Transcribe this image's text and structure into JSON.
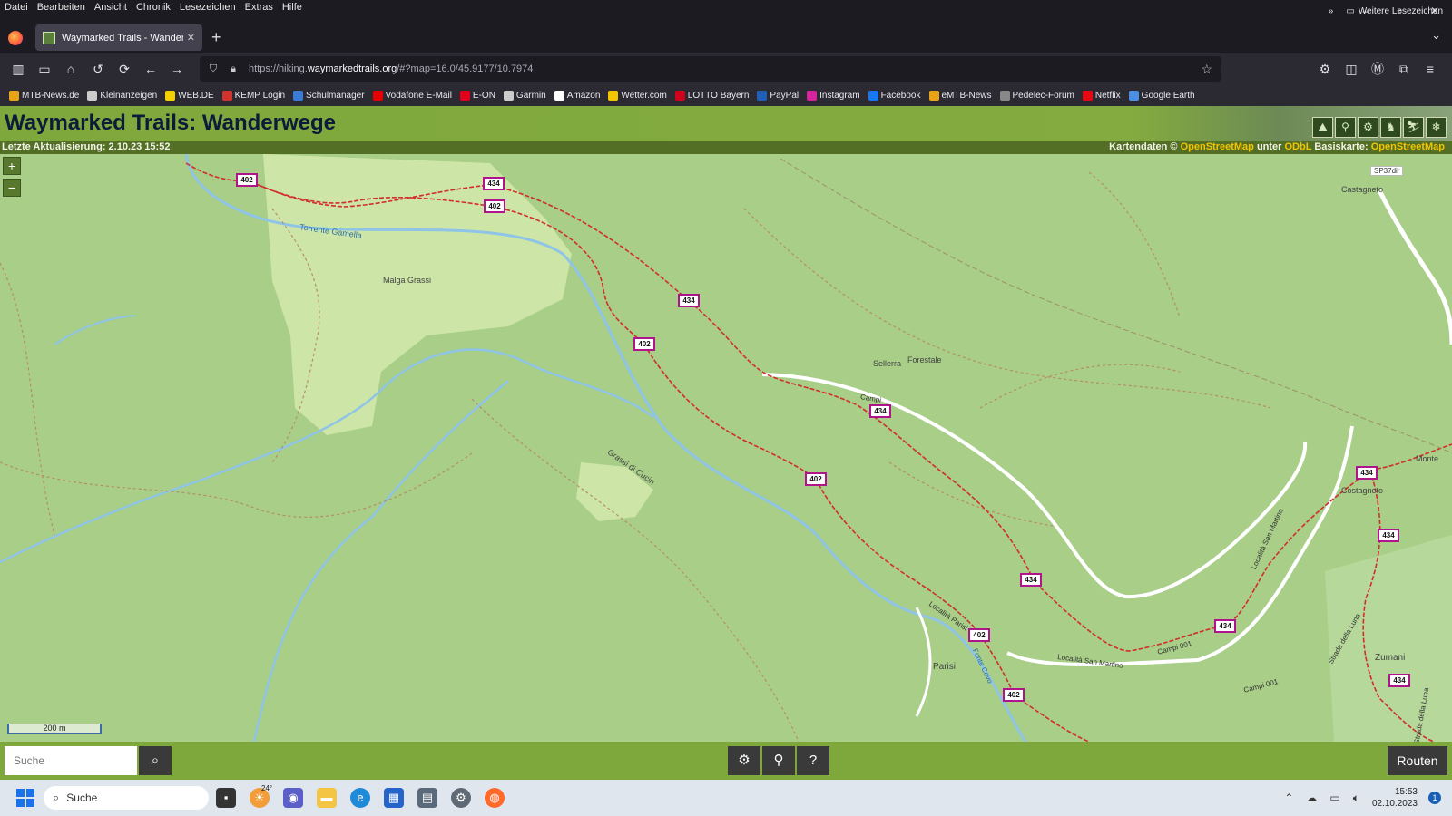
{
  "menu": [
    "Datei",
    "Bearbeiten",
    "Ansicht",
    "Chronik",
    "Lesezeichen",
    "Extras",
    "Hilfe"
  ],
  "window_controls": {
    "minimize": "–",
    "maximize": "▫",
    "close": "✕"
  },
  "tab": {
    "title": "Waymarked Trails - Wanderwe",
    "close": "✕",
    "new_tab": "+",
    "list": "⌄"
  },
  "address": {
    "prefix": "https://hiking.",
    "host": "waymarkedtrails.org",
    "path": "/#?map=16.0/45.9177/10.7974"
  },
  "bookmarks": [
    {
      "label": "MTB-News.de",
      "color": "#e8a317"
    },
    {
      "label": "Kleinanzeigen",
      "color": "#cccccc"
    },
    {
      "label": "WEB.DE",
      "color": "#f4d000"
    },
    {
      "label": "KEMP Login",
      "color": "#d0342c"
    },
    {
      "label": "Schulmanager",
      "color": "#3a7bd5"
    },
    {
      "label": "Vodafone E-Mail",
      "color": "#e60000"
    },
    {
      "label": "E-ON",
      "color": "#e2001a"
    },
    {
      "label": "Garmin",
      "color": "#cccccc"
    },
    {
      "label": "Amazon",
      "color": "#ffffff"
    },
    {
      "label": "Wetter.com",
      "color": "#f4c400"
    },
    {
      "label": "LOTTO Bayern",
      "color": "#d0021b"
    },
    {
      "label": "PayPal",
      "color": "#1f5fb8"
    },
    {
      "label": "Instagram",
      "color": "#d6249f"
    },
    {
      "label": "Facebook",
      "color": "#1877f2"
    },
    {
      "label": "eMTB-News",
      "color": "#e8a317"
    },
    {
      "label": "Pedelec-Forum",
      "color": "#888888"
    },
    {
      "label": "Netflix",
      "color": "#e50914"
    },
    {
      "label": "Google Earth",
      "color": "#4a90e2"
    }
  ],
  "bookmarks_more": "Weitere Lesezeichen",
  "site": {
    "title": "Waymarked Trails: Wanderwege",
    "last_update": "Letzte Aktualisierung: 2.10.23 15:52",
    "attribution_prefix": "Kartendaten ©",
    "attribution_osm": "OpenStreetMap",
    "attribution_unter": "unter",
    "attribution_odbl": "ODbL",
    "attribution_base": "Basiskarte:",
    "attribution_osm2": "OpenStreetMap"
  },
  "map": {
    "zoom_in": "+",
    "zoom_out": "−",
    "scale": "200 m",
    "labels": [
      "Torrente Gamella",
      "Malga Grassi",
      "Grassi di Cucin",
      "Sellerra",
      "Forestale",
      "Castagneto",
      "Costagneto",
      "Parisi",
      "Zumani",
      "Località Parisi",
      "Località San Martino",
      "Località San Martino",
      "Campi 001",
      "Campi 001",
      "Strada della Luna",
      "Strada della Luna",
      "Campi",
      "Fonte Cevo",
      "SP37dir",
      "Monte"
    ],
    "route_badges": [
      "402",
      "434",
      "402",
      "434",
      "402",
      "434",
      "402",
      "434",
      "434",
      "434",
      "402",
      "434",
      "434",
      "402",
      "434"
    ]
  },
  "bottom": {
    "search_placeholder": "Suche",
    "routes": "Routen"
  },
  "taskbar": {
    "search": "Suche",
    "weather_temp": "24°",
    "time": "15:53",
    "date": "02.10.2023",
    "notifications": "1"
  }
}
